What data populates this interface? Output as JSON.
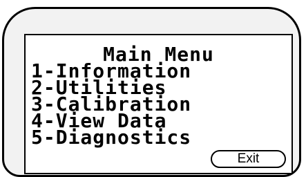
{
  "menu": {
    "title": "Main Menu",
    "items": [
      {
        "label": "1-Information"
      },
      {
        "label": "2-Utilities"
      },
      {
        "label": "3-Calibration"
      },
      {
        "label": "4-View Data"
      },
      {
        "label": "5-Diagnostics"
      }
    ]
  },
  "buttons": {
    "exit_label": "Exit"
  }
}
